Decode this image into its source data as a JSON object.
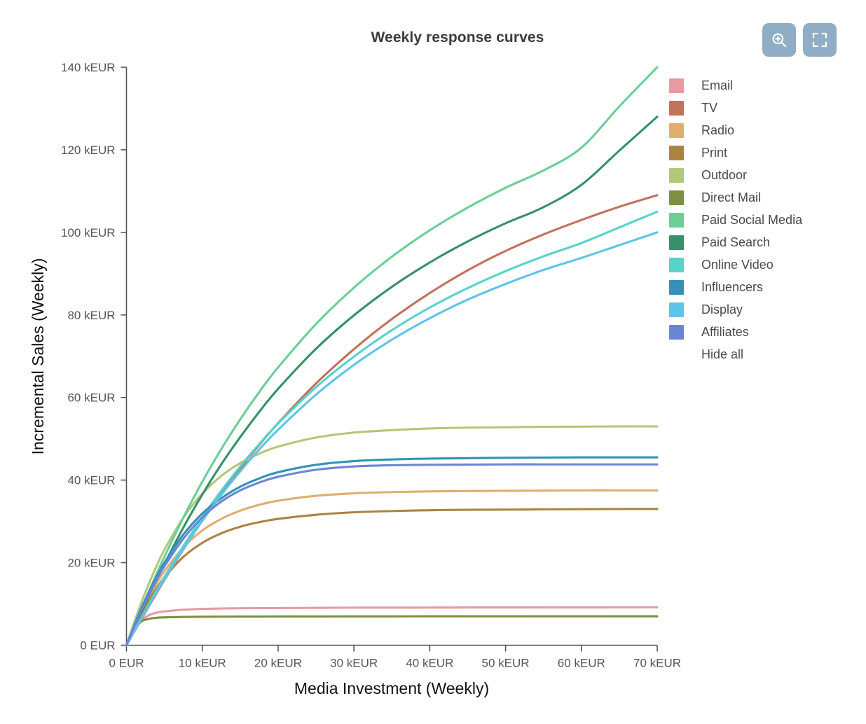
{
  "toolbar": {
    "buttons": [
      {
        "name": "zoom-in-button",
        "icon": "magnifier-plus-icon",
        "title": "Zoom"
      },
      {
        "name": "fullscreen-button",
        "icon": "expand-icon",
        "title": "Fullscreen"
      }
    ],
    "button_color": "#8fadc4"
  },
  "legend": {
    "hide_all_label": "Hide all",
    "items": [
      {
        "label": "Email",
        "color": "#e89aa4"
      },
      {
        "label": "TV",
        "color": "#c4705d"
      },
      {
        "label": "Radio",
        "color": "#e0ae6d"
      },
      {
        "label": "Print",
        "color": "#ac8442"
      },
      {
        "label": "Outdoor",
        "color": "#b3c878"
      },
      {
        "label": "Direct Mail",
        "color": "#7e8f42"
      },
      {
        "label": "Paid Social Media",
        "color": "#6bcf96"
      },
      {
        "label": "Paid Search",
        "color": "#35916a"
      },
      {
        "label": "Online Video",
        "color": "#58d2cb"
      },
      {
        "label": "Influencers",
        "color": "#3292b8"
      },
      {
        "label": "Display",
        "color": "#5ec4e8"
      },
      {
        "label": "Affiliates",
        "color": "#6b85d6"
      }
    ]
  },
  "chart_data": {
    "type": "line",
    "title": "Weekly response curves",
    "xlabel": "Media Investment (Weekly)",
    "ylabel": "Incremental Sales (Weekly)",
    "xlim": [
      0,
      70
    ],
    "ylim": [
      0,
      140
    ],
    "grid": false,
    "legend_position": "right",
    "x_unit": "kEUR",
    "y_unit": "kEUR",
    "xticks": [
      0,
      10,
      20,
      30,
      40,
      50,
      60,
      70
    ],
    "xticklabels": [
      "0 EUR",
      "10 kEUR",
      "20 kEUR",
      "30 kEUR",
      "40 kEUR",
      "50 kEUR",
      "60 kEUR",
      "70 kEUR"
    ],
    "yticks": [
      0,
      20,
      40,
      60,
      80,
      100,
      120,
      140
    ],
    "yticklabels": [
      "0 EUR",
      "20 kEUR",
      "40 kEUR",
      "60 kEUR",
      "80 kEUR",
      "100 kEUR",
      "120 kEUR",
      "140 kEUR"
    ],
    "x": [
      0,
      1,
      2,
      3,
      4,
      5,
      7.5,
      10,
      12.5,
      15,
      17.5,
      20,
      25,
      30,
      35,
      40,
      45,
      50,
      55,
      60,
      65,
      70
    ],
    "series": [
      {
        "name": "Email",
        "color": "#e89aa4",
        "values": [
          0,
          3.6,
          6.1,
          7.3,
          7.9,
          8.2,
          8.6,
          8.8,
          8.9,
          8.95,
          9.0,
          9.0,
          9.05,
          9.1,
          9.1,
          9.12,
          9.14,
          9.15,
          9.16,
          9.17,
          9.18,
          9.2
        ]
      },
      {
        "name": "TV",
        "color": "#c4705d",
        "values": [
          0,
          3.2,
          6.4,
          9.6,
          12.7,
          15.8,
          23.2,
          30.2,
          36.7,
          42.8,
          48.5,
          53.8,
          63.4,
          71.7,
          79.0,
          85.3,
          90.8,
          95.5,
          99.5,
          103.0,
          106.2,
          109.0
        ]
      },
      {
        "name": "Radio",
        "color": "#e0ae6d",
        "values": [
          0,
          4.2,
          8.2,
          11.8,
          15.0,
          17.9,
          23.7,
          27.8,
          30.6,
          32.6,
          34.0,
          35.0,
          36.2,
          36.8,
          37.1,
          37.25,
          37.35,
          37.4,
          37.45,
          37.5,
          37.5,
          37.5
        ]
      },
      {
        "name": "Print",
        "color": "#ac8442",
        "values": [
          0,
          4.0,
          7.7,
          11.0,
          13.9,
          16.4,
          21.4,
          24.8,
          27.1,
          28.7,
          29.8,
          30.6,
          31.6,
          32.2,
          32.5,
          32.7,
          32.8,
          32.85,
          32.9,
          32.95,
          33.0,
          33.0
        ]
      },
      {
        "name": "Outdoor",
        "color": "#b3c878",
        "values": [
          0,
          5.4,
          10.5,
          15.1,
          19.3,
          23.1,
          30.9,
          36.7,
          41.0,
          44.1,
          46.4,
          48.1,
          50.3,
          51.5,
          52.1,
          52.5,
          52.7,
          52.8,
          52.9,
          52.95,
          53.0,
          53.0
        ]
      },
      {
        "name": "Direct Mail",
        "color": "#7e8f42",
        "values": [
          0,
          3.9,
          5.8,
          6.4,
          6.65,
          6.75,
          6.85,
          6.9,
          6.92,
          6.94,
          6.95,
          6.96,
          6.97,
          6.98,
          6.99,
          7.0,
          7.0,
          7.0,
          7.0,
          7.0,
          7.0,
          7.0
        ]
      },
      {
        "name": "Paid Social Media",
        "color": "#6bcf96",
        "values": [
          0,
          4.5,
          8.9,
          13.2,
          17.4,
          21.4,
          30.9,
          39.6,
          47.5,
          54.7,
          61.3,
          67.3,
          77.8,
          86.6,
          94.1,
          100.5,
          106.0,
          110.8,
          115.0,
          120.5,
          130.5,
          140.0
        ]
      },
      {
        "name": "Paid Search",
        "color": "#35916a",
        "values": [
          0,
          4.1,
          8.2,
          12.2,
          16.0,
          19.7,
          28.5,
          36.5,
          43.8,
          50.4,
          56.5,
          62.1,
          71.8,
          79.9,
          86.8,
          92.7,
          97.8,
          102.2,
          106.1,
          111.5,
          119.8,
          128.0
        ]
      },
      {
        "name": "Online Video",
        "color": "#58d2cb",
        "values": [
          0,
          3.4,
          6.8,
          10.1,
          13.4,
          16.5,
          24.0,
          31.0,
          37.4,
          43.3,
          48.7,
          53.7,
          62.5,
          69.9,
          76.3,
          81.8,
          86.5,
          90.6,
          94.2,
          97.4,
          101.2,
          105.0
        ]
      },
      {
        "name": "Influencers",
        "color": "#3292b8",
        "values": [
          0,
          4.7,
          9.1,
          13.1,
          16.7,
          20.0,
          26.8,
          31.9,
          35.6,
          38.4,
          40.4,
          41.9,
          43.7,
          44.6,
          45.0,
          45.2,
          45.3,
          45.4,
          45.45,
          45.5,
          45.5,
          45.5
        ]
      },
      {
        "name": "Display",
        "color": "#5ec4e8",
        "values": [
          0,
          3.3,
          6.6,
          9.8,
          13.0,
          16.0,
          23.3,
          30.1,
          36.4,
          42.1,
          47.4,
          52.2,
          60.7,
          67.9,
          74.0,
          79.2,
          83.7,
          87.5,
          90.9,
          93.8,
          96.9,
          100.0
        ]
      },
      {
        "name": "Affiliates",
        "color": "#6b85d6",
        "values": [
          0,
          4.4,
          8.6,
          12.4,
          15.9,
          19.1,
          25.8,
          31.0,
          34.8,
          37.5,
          39.4,
          40.8,
          42.5,
          43.3,
          43.6,
          43.7,
          43.75,
          43.8,
          43.8,
          43.8,
          43.8,
          43.8
        ]
      }
    ]
  }
}
